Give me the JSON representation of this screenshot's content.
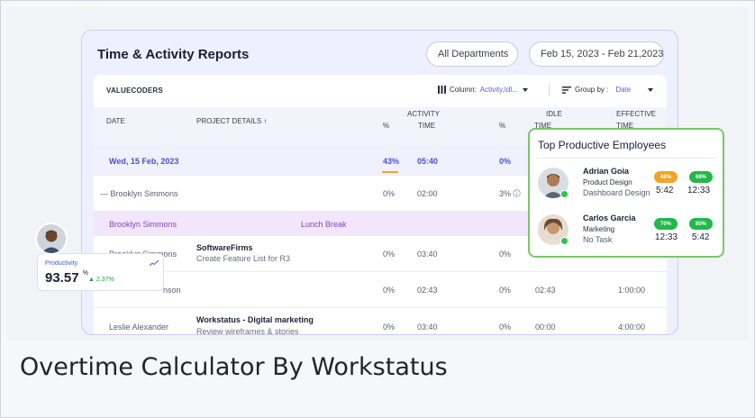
{
  "caption": "Overtime Calculator By Workstatus",
  "header": {
    "title": "Time & Activity Reports",
    "department_select": "All Departments",
    "date_range": "Feb 15, 2023 - Feb 21,2023"
  },
  "toolbar": {
    "org_name": "VALUECODERS",
    "column_label": "Column:",
    "column_value": "Activity,Idl...",
    "group_label": "Group by :",
    "group_value": "Date"
  },
  "columns": {
    "date": "DATE",
    "project": "PROJECT DETAILS ↑",
    "activity": "ACTIVITY",
    "idle": "IDLE",
    "effective": "EFFECTIVE",
    "pct": "%",
    "time": "TIME"
  },
  "rows": [
    {
      "date": "Wed, 15 Feb, 2023",
      "pct": "43%",
      "time": "05:40",
      "idle_pct": "0%"
    },
    {
      "name": "— Brooklyn Simmons",
      "pct": "0%",
      "time": "02:00",
      "idle_pct": "3%"
    },
    {
      "name": "Brooklyn Simmons",
      "note": "Lunch Break"
    },
    {
      "name": "Brooklyn Simmons",
      "project": "SoftwareFirms",
      "task": "Create Feature List for R3",
      "pct": "0%",
      "time": "03:40",
      "idle_pct": "0%"
    },
    {
      "name": "nson",
      "pct": "0%",
      "time": "02:43",
      "idle_pct": "0%",
      "idle_time": "02:43",
      "effective": "1:00:00"
    },
    {
      "name": "Leslie Alexander",
      "project": "Workstatus - Digital marketing",
      "task": "Review wireframes & stories",
      "pct": "0%",
      "time": "03:40",
      "idle_pct": "0%",
      "idle_time": "00:00",
      "effective": "4:00:00"
    }
  ],
  "top_productive": {
    "title": "Top Productive Employees",
    "employees": [
      {
        "name": "Adrian Goia",
        "role": "Product Design",
        "task": "Dashboard Design",
        "badge1": "48%",
        "badge2": "68%",
        "time1": "5:42",
        "time2": "12:33"
      },
      {
        "name": "Carlos Garcia",
        "role": "Marketing",
        "task": "No Task",
        "badge1": "70%",
        "badge2": "80%",
        "time1": "12:33",
        "time2": "5:42"
      }
    ]
  },
  "productivity": {
    "label": "Productivity",
    "value": "93.57",
    "unit": "%",
    "delta": "▲ 2.37%"
  },
  "colors": {
    "accent": "#4b4fd1",
    "break": "#8c3fc4",
    "orange_badge": "#f3a325",
    "green_badge": "#22b84a"
  }
}
